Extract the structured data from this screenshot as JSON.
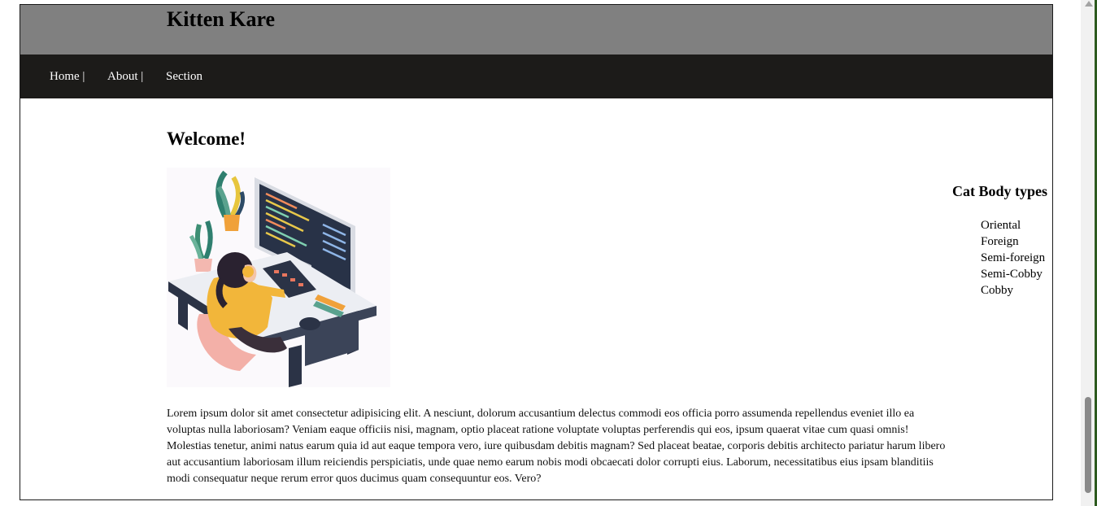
{
  "header": {
    "title": "Kitten Kare"
  },
  "nav": {
    "items": [
      {
        "label": "Home |"
      },
      {
        "label": "About |"
      },
      {
        "label": "Section"
      }
    ]
  },
  "main": {
    "heading": "Welcome!",
    "image_icon": "person-at-computer-illustration",
    "paragraph": "Lorem ipsum dolor sit amet consectetur adipisicing elit. A nesciunt, dolorum accusantium delectus commodi eos officia porro assumenda repellendus eveniet illo ea voluptas nulla laboriosam? Veniam eaque officiis nisi, magnam, optio placeat ratione voluptate voluptas perferendis qui eos, ipsum quaerat vitae cum quasi omnis! Molestias tenetur, animi natus earum quia id aut eaque tempora vero, iure quibusdam debitis magnam? Sed placeat beatae, corporis debitis architecto pariatur harum libero aut accusantium laboriosam illum reiciendis perspiciatis, unde quae nemo earum nobis modi obcaecati dolor corrupti eius. Laborum, necessitatibus eius ipsam blanditiis modi consequatur neque rerum error quos ducimus quam consequuntur eos. Vero?"
  },
  "aside": {
    "heading": "Cat Body types",
    "items": [
      "Oriental",
      "Foreign",
      "Semi-foreign",
      "Semi-Cobby",
      "Cobby"
    ]
  },
  "colors": {
    "header_bg": "#808080",
    "nav_bg": "#1c1b19",
    "nav_text": "#ffffff"
  }
}
